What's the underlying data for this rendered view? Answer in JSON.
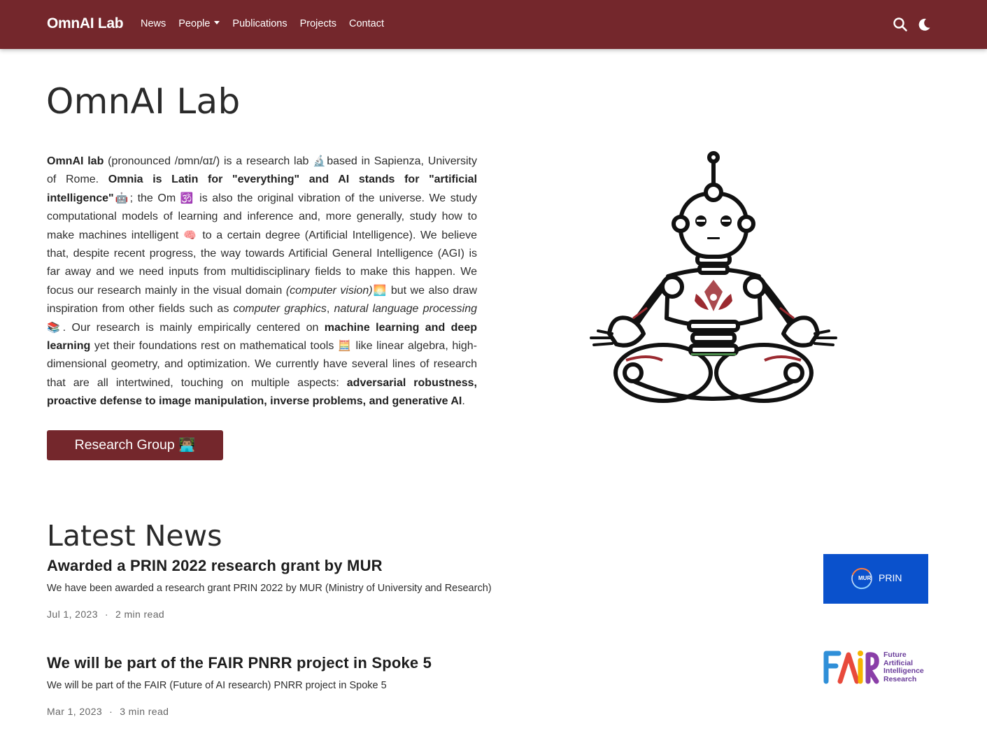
{
  "navbar": {
    "brand": "OmnAI Lab",
    "links": [
      "News",
      "People",
      "Publications",
      "Projects",
      "Contact"
    ]
  },
  "hero": {
    "title": "OmnAI Lab",
    "intro": {
      "p1": "OmnAI lab",
      "p2": " (pronounced /ɒmn/ɑɪ/) is a research lab ",
      "e1": "🔬",
      "p3": "based in Sapienza, University of Rome. ",
      "p4": "Omnia is Latin for \"everything\" and AI stands for \"artificial intelligence\"",
      "e2": "🤖",
      "p5": "; the Om ",
      "e3": "🕉️",
      "p6": " is also the original vibration of the universe. We study computational models of learning and inference and, more generally, study how to make machines intelligent ",
      "e4": "🧠",
      "p7": " to a certain degree (Artificial Intelligence). We believe that, despite recent progress, the way towards Artificial General Intelligence (AGI) is far away and we need inputs from multidisciplinary fields to make this happen. We focus our research mainly in the visual domain ",
      "p8": "(computer vision)",
      "e5": "🌅",
      "p9": " but we also draw inspiration from other fields such as ",
      "p10": "computer graphics",
      "p11": ", ",
      "p12": "natural language processing",
      "e6": " 📚",
      "p13": ". Our research is mainly empirically centered on ",
      "p14": "machine learning and deep learning",
      "p15": " yet their foundations rest on mathematical tools ",
      "e7": "🧮",
      "p16": " like linear algebra, high-dimensional geometry, and optimization. We currently have several lines of research that are all intertwined, touching on multiple aspects: ",
      "p17": "adversarial robustness, proactive defense to image manipulation, inverse problems, and generative AI",
      "p18": "."
    },
    "button_label": "Research Group 👨🏽‍💻"
  },
  "news": {
    "heading": "Latest News",
    "posts": [
      {
        "title": "Awarded a PRIN 2022 research grant by MUR",
        "summary": "We have been awarded a research grant PRIN 2022 by MUR (Ministry of University and Research)",
        "date": "Jul 1, 2023",
        "sep": "·",
        "read_time": "2 min read",
        "thumb_small": "MUR",
        "thumb_text": "PRIN"
      },
      {
        "title": "We will be part of the FAIR PNRR project in Spoke 5",
        "summary": "We will be part of the FAIR (Future of AI research) PNRR project in Spoke 5",
        "date": "Mar 1, 2023",
        "sep": "·",
        "read_time": "3 min read",
        "thumb_logo": "FAiR",
        "thumb_lines": [
          "Future",
          "Artificial",
          "Intelligence",
          "Research"
        ]
      }
    ]
  },
  "colors": {
    "brand": "#74272c",
    "prin_blue": "#0a51cc",
    "fair_purple": "#6a3d9a"
  }
}
